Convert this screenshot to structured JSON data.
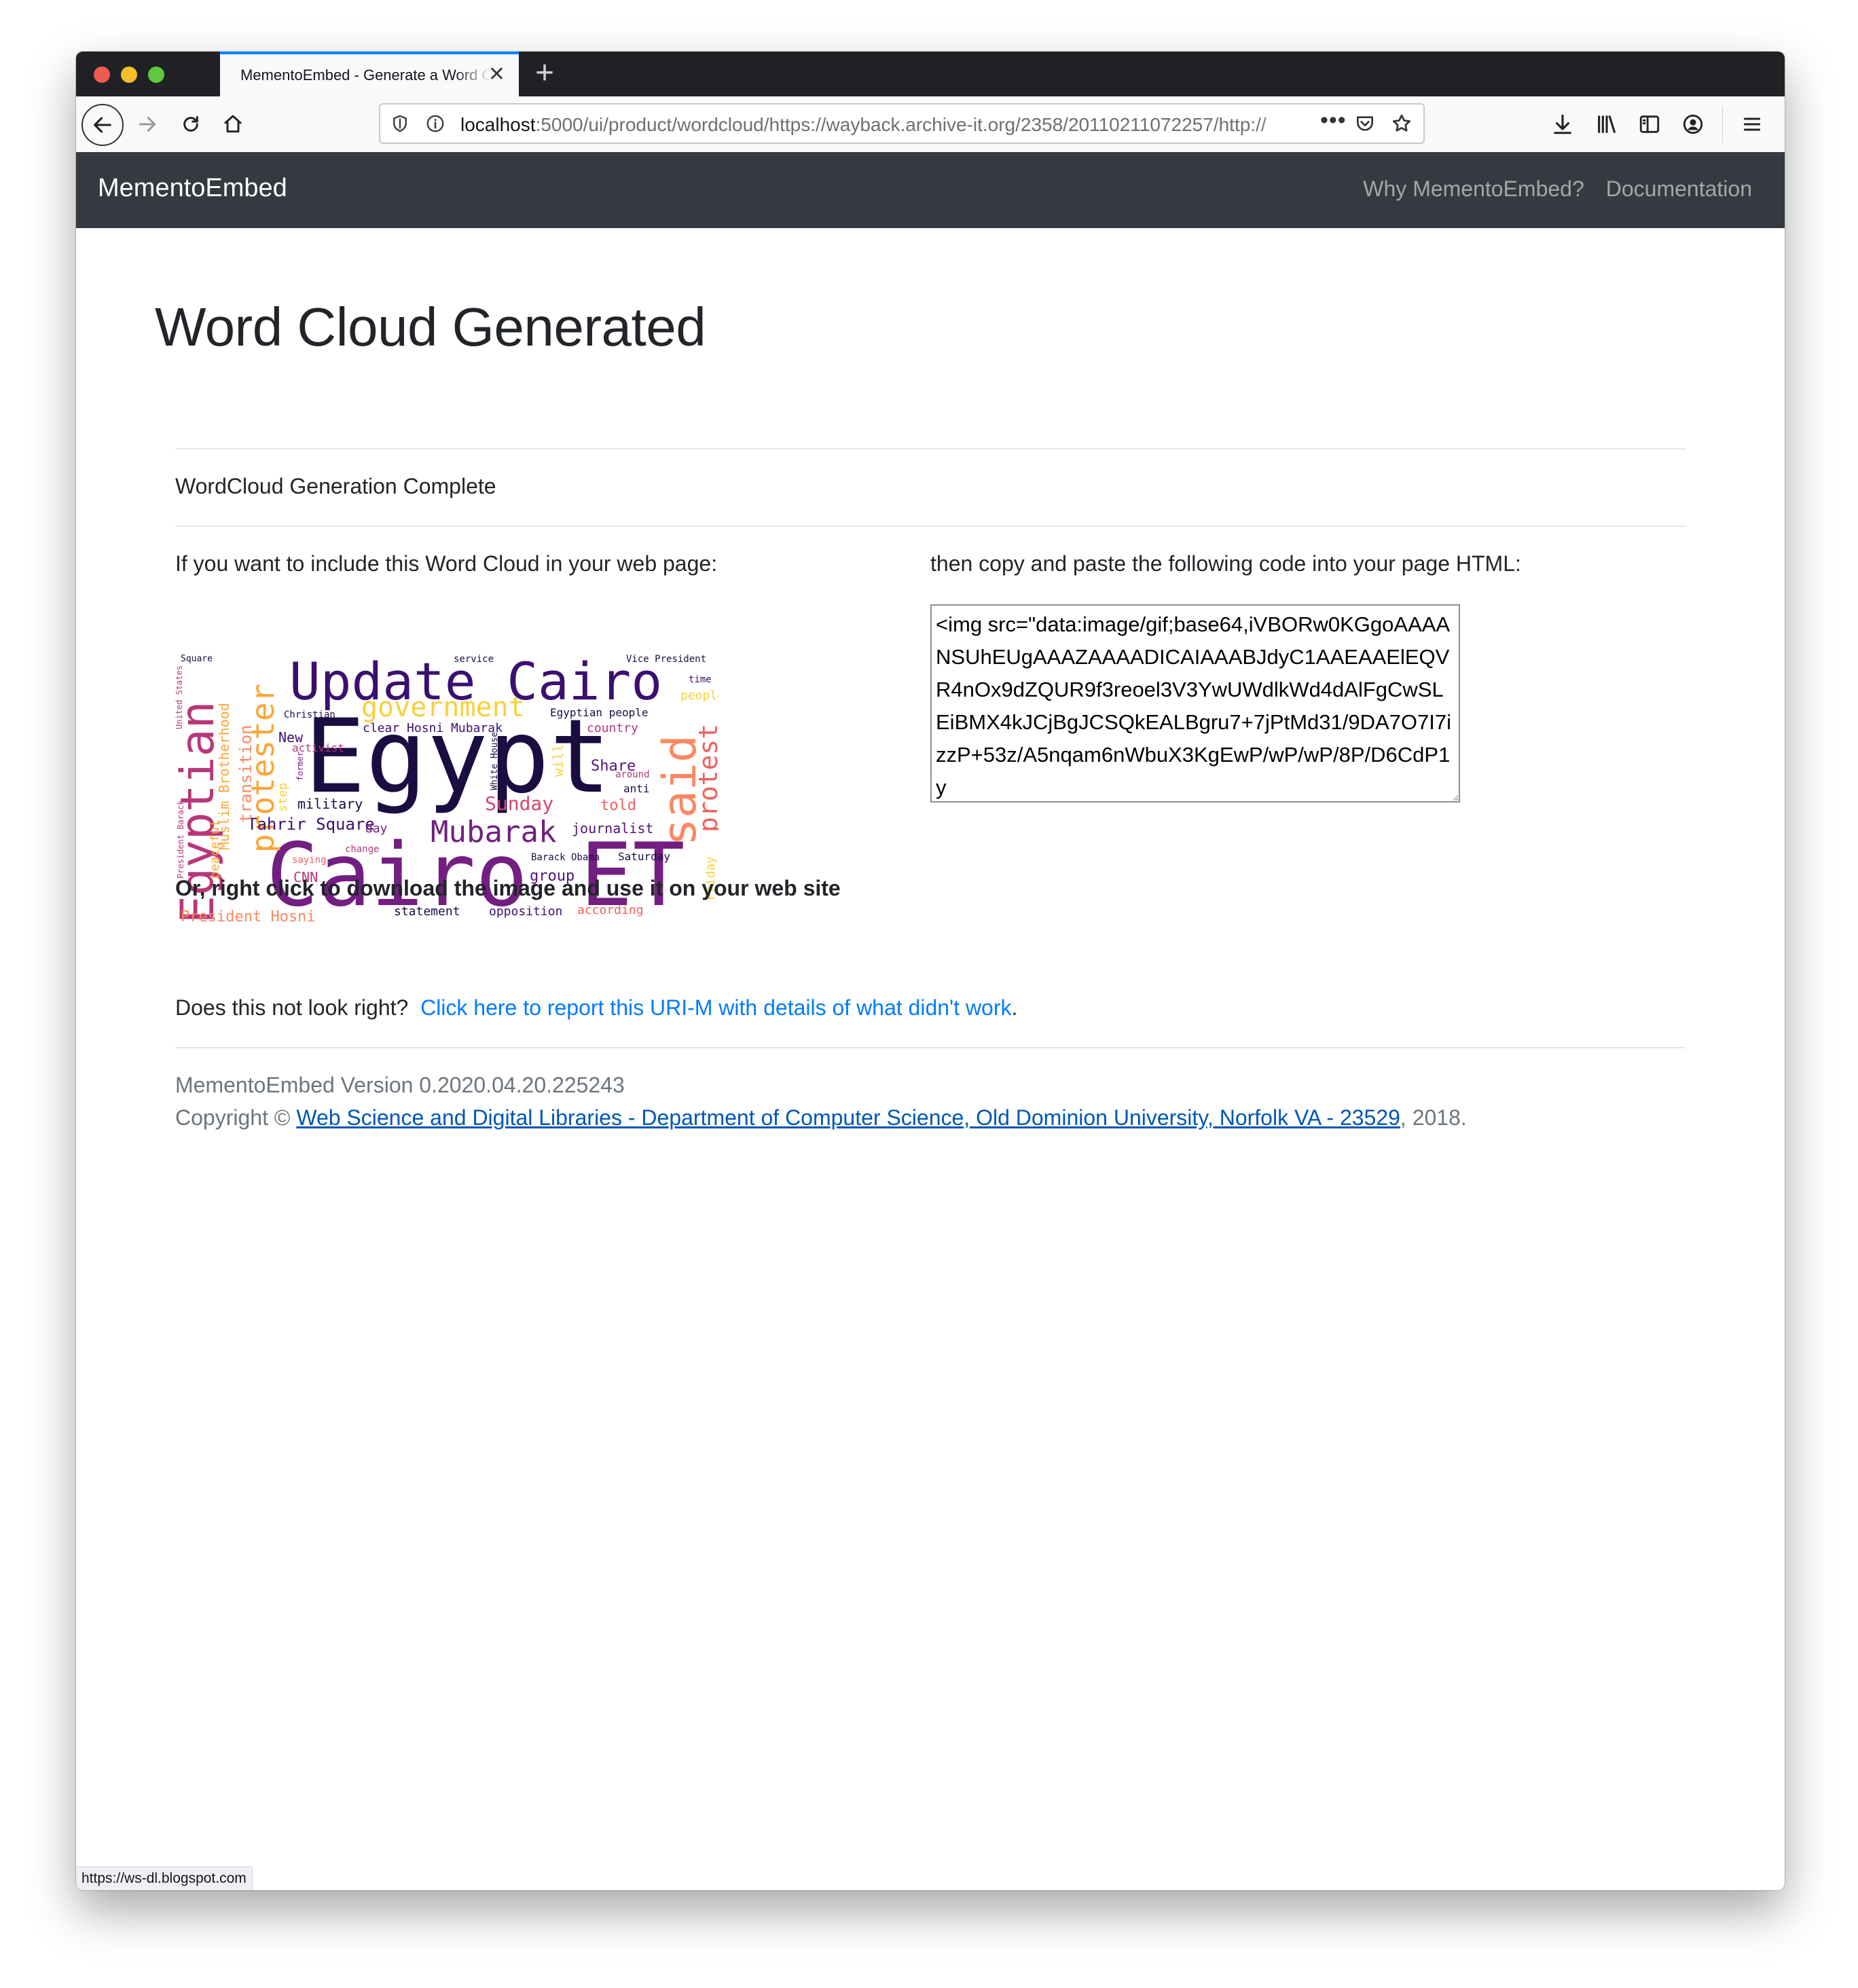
{
  "browser": {
    "tab_title": "MementoEmbed - Generate a Word Cloud",
    "url_host": "localhost",
    "url_rest": ":5000/ui/product/wordcloud/https://wayback.archive-it.org/2358/20110211072257/http://",
    "status_url": "https://ws-dl.blogspot.com"
  },
  "site": {
    "brand": "MementoEmbed",
    "nav_why": "Why MementoEmbed?",
    "nav_docs": "Documentation"
  },
  "page": {
    "title": "Word Cloud Generated",
    "status_message": "WordCloud Generation Complete",
    "include_prompt": "If you want to include this Word Cloud in your web page:",
    "copy_prompt": "then copy and paste the following code into your page HTML:",
    "code_value": "<img src=\"data:image/gif;base64,iVBORw0KGgoAAAANSUhEUgAAAZAAAADICAIAAABJdyC1AAEAAElEQVR4nOx9dZQUR9f3reoel3V3YwUWdlkWd4dAlFgCwSLEiBMX4kJCjBgJCSQkEALBgru7+7jPtMd31/9DA7O7I7izzP+53z/A5nqam6nWbuX3KgEwP/wP/wP/8P/D6CdP1y",
    "download_hint": "Or, right click to download the image and use it on your web site",
    "report_prompt": "Does this not look right?",
    "report_link": "Click here to report this URI-M with details of what didn't work",
    "report_tail": "."
  },
  "footer": {
    "version": "MementoEmbed Version 0.2020.04.20.225243",
    "copyright_prefix": "Copyright ©",
    "copyright_link": "Web Science and Digital Libraries - Department of Computer Science, Old Dominion University, Norfolk VA - 23529",
    "copyright_suffix": ", 2018."
  },
  "wordcloud": {
    "words": [
      "Update Cairo",
      "Egypt",
      "Cairo ET",
      "Egyptian",
      "said",
      "protester",
      "protest",
      "Mubarak",
      "government",
      "Tahrir Square",
      "Muslim Brotherhood",
      "transition",
      "Sunday",
      "military",
      "Share",
      "told",
      "journalist",
      "President Hosni",
      "clear Hosni Mubarak",
      "Egyptian people",
      "country",
      "statement",
      "opposition",
      "according",
      "CNN",
      "group",
      "Barack Obama",
      "Saturday",
      "Friday",
      "day",
      "change",
      "Christian",
      "New",
      "activist",
      "peaceful",
      "Vice President",
      "service",
      "time",
      "people",
      "Square",
      "step",
      "White House",
      "anti",
      "around",
      "will",
      "former",
      "President Barack",
      "United States",
      "saying"
    ]
  },
  "colors": {
    "site_nav_bg": "#343a40",
    "link": "#007bff",
    "tab_accent": "#0a84ff"
  }
}
